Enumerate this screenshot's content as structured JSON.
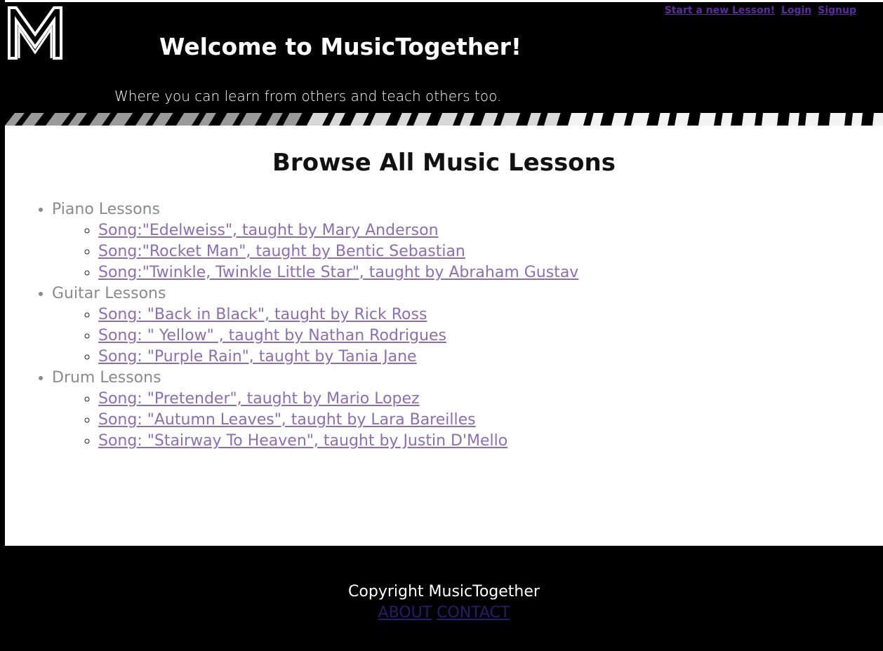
{
  "header": {
    "logo_letter": "M",
    "title": "Welcome to MusicTogether!",
    "tagline": "Where you can learn from others and teach others too.",
    "nav_links": [
      "Start a new Lesson!",
      "Login",
      "Signup"
    ]
  },
  "main": {
    "heading": "Browse All Music Lessons",
    "categories": [
      {
        "label": "Piano Lessons",
        "lessons": [
          "Song:\"Edelweiss\", taught by Mary Anderson",
          "Song:\"Rocket Man\", taught by Bentic Sebastian",
          "Song:\"Twinkle, Twinkle Little Star\", taught by Abraham Gustav"
        ]
      },
      {
        "label": "Guitar Lessons",
        "lessons": [
          "Song: \"Back in Black\", taught by Rick Ross",
          "Song: \" Yellow\" , taught by Nathan Rodrigues",
          "Song: \"Purple Rain\", taught by Tania Jane"
        ]
      },
      {
        "label": "Drum Lessons",
        "lessons": [
          "Song: \"Pretender\", taught by Mario Lopez",
          "Song: \"Autumn Leaves\", taught by Lara Bareilles",
          "Song: \"Stairway To Heaven\", taught by Justin D'Mello"
        ]
      }
    ]
  },
  "footer": {
    "copyright": "Copyright MusicTogether",
    "links": [
      "ABOUT",
      "CONTACT"
    ]
  },
  "colors": {
    "header_bg": "#000000",
    "visited_link": "#8b6fb0",
    "nav_link": "#5b2ca0",
    "footer_link": "#2a1a6e"
  }
}
